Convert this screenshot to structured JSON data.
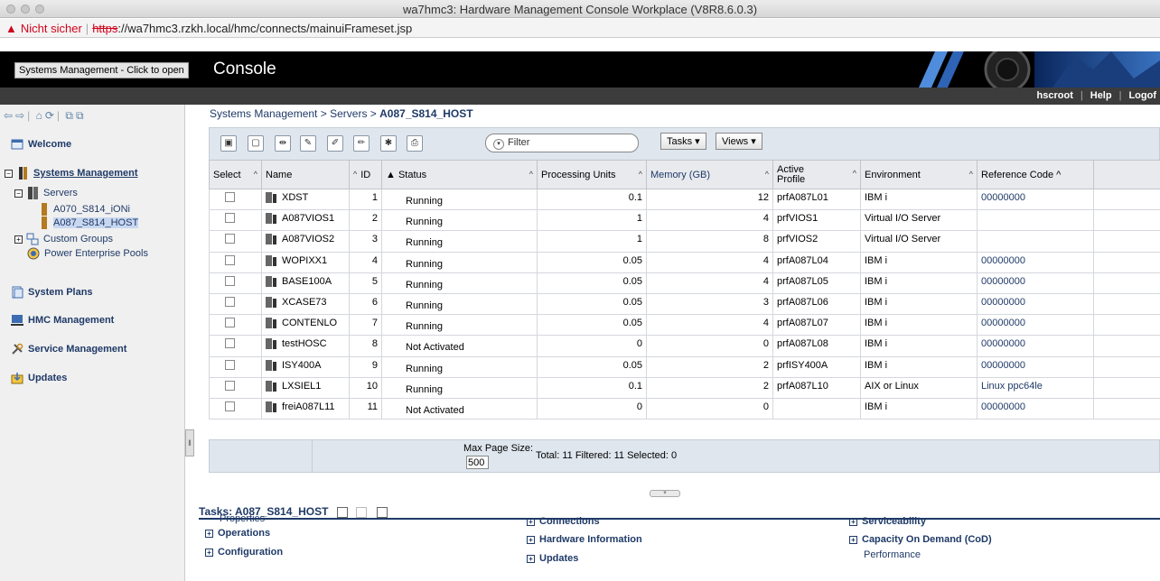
{
  "window": {
    "title": "wa7hmc3: Hardware Management Console Workplace (V8R8.6.0.3)"
  },
  "urlbar": {
    "insecure_label": "Nicht sicher",
    "scheme": "https",
    "rest": "://wa7hmc3.rzkh.local/hmc/connects/mainuiFrameset.jsp"
  },
  "banner": {
    "button_label": "Systems Management - Click to open",
    "title": "Console"
  },
  "userbar": {
    "user": "hscroot",
    "help": "Help",
    "logoff": "Logof"
  },
  "nav": {
    "welcome": "Welcome",
    "systems_management": "Systems Management",
    "servers": "Servers",
    "server1": "A070_S814_iONi",
    "server2": "A087_S814_HOST",
    "custom_groups": "Custom Groups",
    "power_pools": "Power Enterprise Pools",
    "system_plans": "System Plans",
    "hmc_management": "HMC Management",
    "service_management": "Service Management",
    "updates": "Updates"
  },
  "breadcrumb": {
    "part1": "Systems Management",
    "sep": ">",
    "part2": "Servers",
    "current": "A087_S814_HOST"
  },
  "toolbar": {
    "filter_placeholder": "Filter",
    "tasks_label": "Tasks ▾",
    "views_label": "Views ▾"
  },
  "columns": {
    "select": "Select",
    "name": "Name",
    "id": "ID",
    "status": "Status",
    "processing_units": "Processing Units",
    "memory": "Memory (GB)",
    "active_profile_1": "Active",
    "active_profile_2": "Profile",
    "environment": "Environment",
    "reference_code": "Reference Code"
  },
  "rows": [
    {
      "name": "XDST",
      "id": "1",
      "status": "Running",
      "pu": "0.1",
      "mem": "12",
      "profile": "prfA087L01",
      "env": "IBM i",
      "ref": "00000000"
    },
    {
      "name": "A087VIOS1",
      "id": "2",
      "status": "Running",
      "pu": "1",
      "mem": "4",
      "profile": "prfVIOS1",
      "env": "Virtual I/O Server",
      "ref": ""
    },
    {
      "name": "A087VIOS2",
      "id": "3",
      "status": "Running",
      "pu": "1",
      "mem": "8",
      "profile": "prfVIOS2",
      "env": "Virtual I/O Server",
      "ref": ""
    },
    {
      "name": "WOPIXX1",
      "id": "4",
      "status": "Running",
      "pu": "0.05",
      "mem": "4",
      "profile": "prfA087L04",
      "env": "IBM i",
      "ref": "00000000"
    },
    {
      "name": "BASE100A",
      "id": "5",
      "status": "Running",
      "pu": "0.05",
      "mem": "4",
      "profile": "prfA087L05",
      "env": "IBM i",
      "ref": "00000000"
    },
    {
      "name": "XCASE73",
      "id": "6",
      "status": "Running",
      "pu": "0.05",
      "mem": "3",
      "profile": "prfA087L06",
      "env": "IBM i",
      "ref": "00000000"
    },
    {
      "name": "CONTENLO",
      "id": "7",
      "status": "Running",
      "pu": "0.05",
      "mem": "4",
      "profile": "prfA087L07",
      "env": "IBM i",
      "ref": "00000000"
    },
    {
      "name": "testHOSC",
      "id": "8",
      "status": "Not Activated",
      "pu": "0",
      "mem": "0",
      "profile": "prfA087L08",
      "env": "IBM i",
      "ref": "00000000"
    },
    {
      "name": "ISY400A",
      "id": "9",
      "status": "Running",
      "pu": "0.05",
      "mem": "2",
      "profile": "prfISY400A",
      "env": "IBM i",
      "ref": "00000000"
    },
    {
      "name": "LXSIEL1",
      "id": "10",
      "status": "Running",
      "pu": "0.1",
      "mem": "2",
      "profile": "prfA087L10",
      "env": "AIX or Linux",
      "ref": "Linux ppc64le"
    },
    {
      "name": "freiA087L11",
      "id": "11",
      "status": "Not Activated",
      "pu": "0",
      "mem": "0",
      "profile": "",
      "env": "IBM i",
      "ref": "00000000"
    }
  ],
  "footer": {
    "max_page_size_label": "Max Page Size:",
    "max_page_size_value": "500",
    "totals": "Total: 11   Filtered: 11   Selected: 0"
  },
  "tasks": {
    "header": "Tasks: A087_S814_HOST",
    "properties": "Properties",
    "operations": "Operations",
    "configuration": "Configuration",
    "connections": "Connections",
    "hardware_information": "Hardware Information",
    "updates": "Updates",
    "serviceability": "Serviceability",
    "cod": "Capacity On Demand (CoD)",
    "performance": "Performance"
  }
}
